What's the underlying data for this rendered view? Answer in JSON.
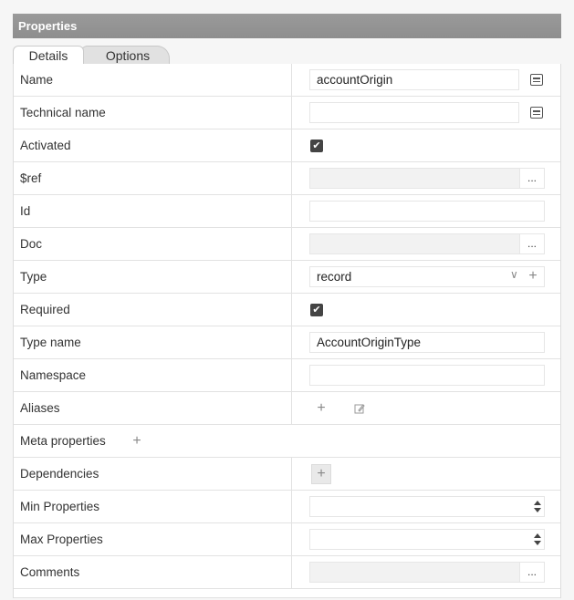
{
  "panel": {
    "title": "Properties"
  },
  "tabs": [
    {
      "label": "Details",
      "active": true
    },
    {
      "label": "Options",
      "active": false
    }
  ],
  "rows": {
    "name": {
      "label": "Name",
      "value": "accountOrigin"
    },
    "technical_name": {
      "label": "Technical name",
      "value": ""
    },
    "activated": {
      "label": "Activated",
      "checked": true
    },
    "ref": {
      "label": "$ref",
      "value": ""
    },
    "id": {
      "label": "Id",
      "value": ""
    },
    "doc": {
      "label": "Doc",
      "value": ""
    },
    "type": {
      "label": "Type",
      "value": "record"
    },
    "required": {
      "label": "Required",
      "checked": true
    },
    "type_name": {
      "label": "Type name",
      "value": "AccountOriginType"
    },
    "namespace": {
      "label": "Namespace",
      "value": ""
    },
    "aliases": {
      "label": "Aliases"
    },
    "meta_properties": {
      "label": "Meta properties"
    },
    "dependencies": {
      "label": "Dependencies"
    },
    "min_properties": {
      "label": "Min Properties",
      "value": ""
    },
    "max_properties": {
      "label": "Max Properties",
      "value": ""
    },
    "comments": {
      "label": "Comments",
      "value": ""
    }
  },
  "glyphs": {
    "ellipsis": "...",
    "plus": "+",
    "chevron": "∨",
    "check": "✔"
  },
  "icons": {
    "name_side": "list-icon",
    "technical_name_side": "list-icon",
    "aliases_edit": "edit-icon"
  }
}
